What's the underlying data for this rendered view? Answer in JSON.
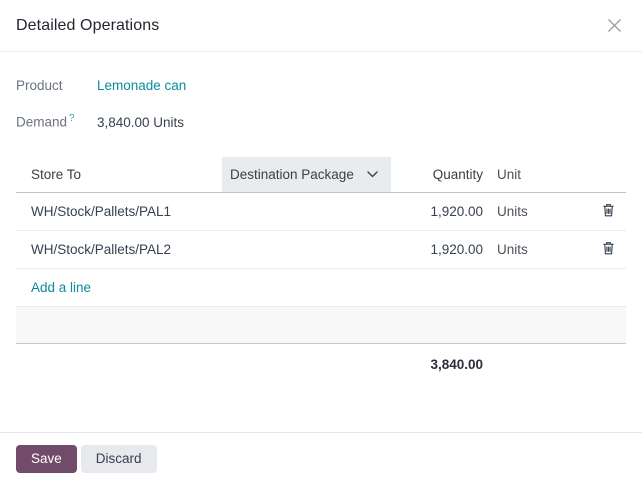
{
  "modal": {
    "title": "Detailed Operations"
  },
  "fields": {
    "product": {
      "label": "Product",
      "value": "Lemonade can"
    },
    "demand": {
      "label": "Demand",
      "help_marker": "?",
      "value": "3,840.00 Units"
    }
  },
  "table": {
    "columns": {
      "store_to": "Store To",
      "destination_package": "Destination Package",
      "quantity": "Quantity",
      "unit": "Unit"
    },
    "rows": [
      {
        "store_to": "WH/Stock/Pallets/PAL1",
        "quantity": "1,920.00",
        "unit": "Units"
      },
      {
        "store_to": "WH/Stock/Pallets/PAL2",
        "quantity": "1,920.00",
        "unit": "Units"
      }
    ],
    "add_line_label": "Add a line",
    "total": "3,840.00"
  },
  "footer": {
    "save_label": "Save",
    "discard_label": "Discard"
  },
  "icons": {
    "close": "x-cross",
    "chevron_down": "chevron-down",
    "delete": "trash-can"
  },
  "colors": {
    "accent_link": "#0a8c9b",
    "primary_button": "#714B67",
    "secondary_button": "#e7e9ed",
    "header_cell_bg": "#e9ecef",
    "text_dark": "#374151",
    "text_muted": "#6b7280"
  }
}
